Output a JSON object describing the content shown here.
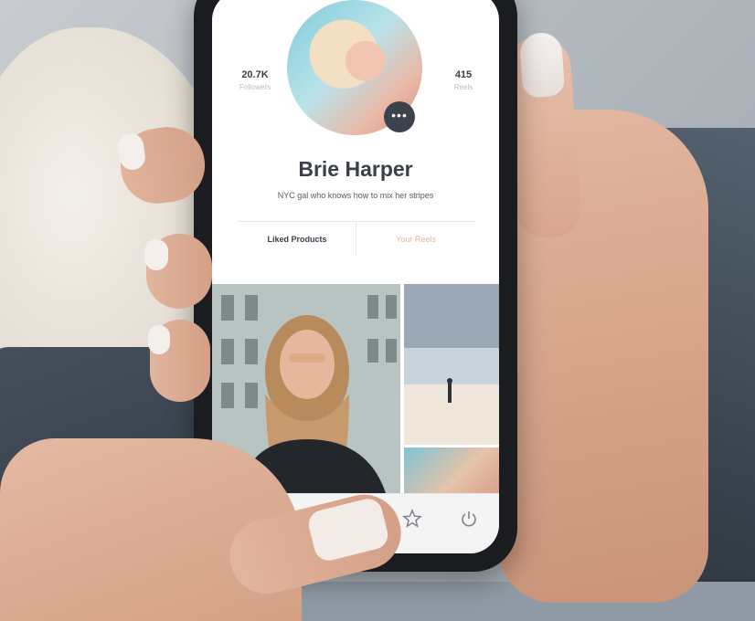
{
  "profile": {
    "name": "Brie Harper",
    "bio": "NYC gal who knows how to mix her stripes",
    "followers_value": "20.7K",
    "followers_label": "Followers",
    "reels_value": "415",
    "reels_label": "Reels",
    "more_label": "•••"
  },
  "tabs": {
    "liked_products": "Liked Products",
    "your_reels": "Your Reels"
  },
  "tabbar": {
    "icons": [
      "list-icon",
      "home-icon",
      "star-icon",
      "power-icon"
    ]
  },
  "colors": {
    "accent": "#e8b59e",
    "text_dark": "#3a3f4a"
  }
}
